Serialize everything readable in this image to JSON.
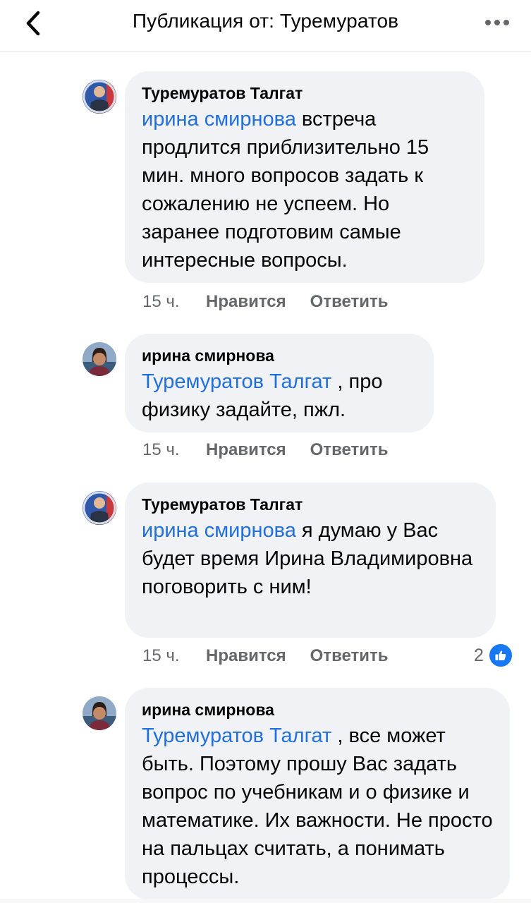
{
  "header": {
    "title": "Публикация от: Туремуратов",
    "back_icon": "chevron-left-icon",
    "more_icon": "more-horizontal-icon"
  },
  "comments": [
    {
      "author": "Туремуратов Талгат",
      "mention": "ирина смирнова",
      "text": " встреча продлится приблизительно 15 мин. много вопросов задать к сожалению не успеем. Но заранее подготовим самые интересные вопросы.",
      "time": "15 ч.",
      "like_label": "Нравится",
      "reply_label": "Ответить"
    },
    {
      "author": "ирина смирнова",
      "mention": "Туремуратов Талгат",
      "text": " , про физику задайте, пжл.",
      "time": "15 ч.",
      "like_label": "Нравится",
      "reply_label": "Ответить"
    },
    {
      "author": "Туремуратов Талгат",
      "mention": "ирина смирнова",
      "text": " я думаю у Вас будет время Ирина Владимировна поговорить с ним!",
      "time": "15 ч.",
      "like_label": "Нравится",
      "reply_label": "Ответить",
      "reactions_count": "2"
    },
    {
      "author": "ирина смирнова",
      "mention": "Туремуратов Талгат",
      "text": " , все может быть. Поэтому прошу Вас задать вопрос по учебникам и о физике и математике. Их важности. Не просто на пальцах считать, а понимать процессы.",
      "time": "",
      "like_label": "",
      "reply_label": ""
    }
  ],
  "colors": {
    "mention": "#216fdb",
    "bubble": "#f0f2f5",
    "meta_text": "#65676b",
    "like_blue": "#1877f2"
  }
}
